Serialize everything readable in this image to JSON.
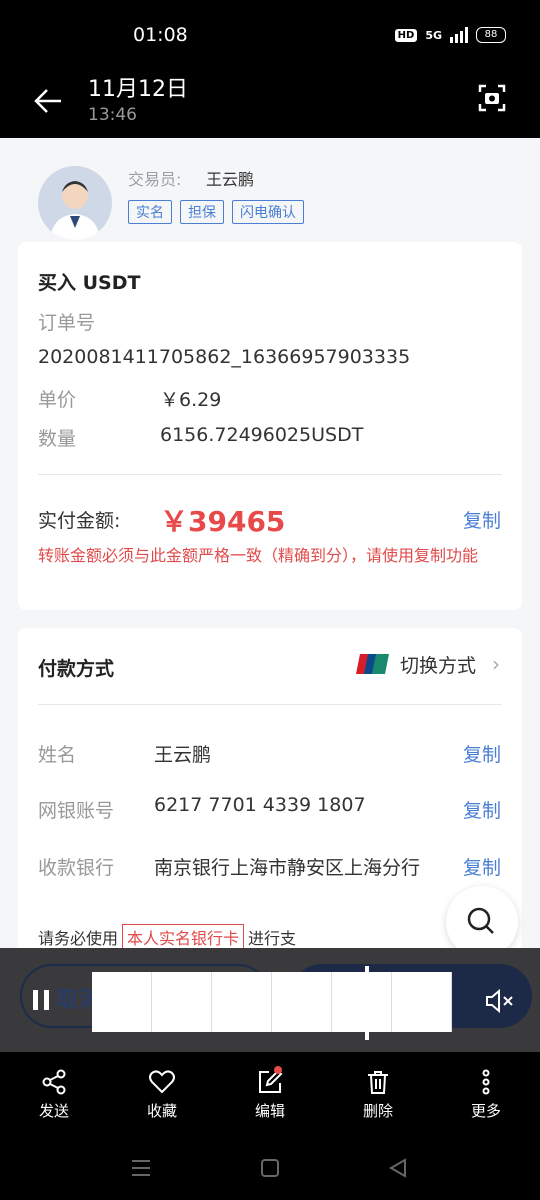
{
  "status_bar": {
    "time": "01:08",
    "hd": "HD",
    "network": "5G",
    "battery": "88"
  },
  "header": {
    "date": "11月12日",
    "time": "13:46"
  },
  "trader": {
    "label": "交易员:",
    "name": "王云鹏",
    "tags": [
      "实名",
      "担保",
      "闪电确认"
    ]
  },
  "order": {
    "title": "买入 USDT",
    "order_no_label": "订单号",
    "order_no": "2020081411705862_16366957903335",
    "price_label": "单价",
    "price": "￥6.29",
    "qty_label": "数量",
    "qty": "6156.72496025USDT",
    "paid_label": "实付金额:",
    "paid": "￥39465",
    "copy": "复制",
    "warning": "转账金额必须与此金额严格一致（精确到分），请使用复制功能"
  },
  "payment": {
    "title": "付款方式",
    "switch": "切换方式",
    "name_label": "姓名",
    "name": "王云鹏",
    "account_label": "网银账号",
    "account": "6217 7701 4339 1807",
    "bank_label": "收款银行",
    "bank": "南京银行上海市静安区上海分行",
    "copy": "复制",
    "notice_pre": "请务必使用",
    "notice_hl": "本人实名银行卡",
    "notice_post": "进行支"
  },
  "video_player": {
    "ghost_text": "取消"
  },
  "bottom_actions": [
    {
      "label": "发送",
      "icon": "share-icon"
    },
    {
      "label": "收藏",
      "icon": "heart-icon"
    },
    {
      "label": "编辑",
      "icon": "edit-icon"
    },
    {
      "label": "删除",
      "icon": "trash-icon"
    },
    {
      "label": "更多",
      "icon": "more-icon"
    }
  ],
  "colors": {
    "accent": "#4a7fd4",
    "price_red": "#e84a4a"
  }
}
